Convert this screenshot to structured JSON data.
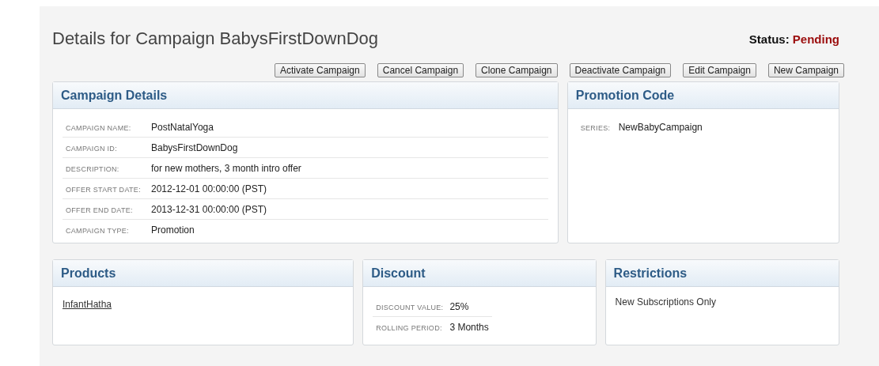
{
  "title": "Details for Campaign BabysFirstDownDog",
  "status": {
    "label": "Status:",
    "value": "Pending"
  },
  "buttons": [
    "Activate Campaign",
    "Cancel Campaign",
    "Clone Campaign",
    "Deactivate Campaign",
    "Edit Campaign",
    "New Campaign"
  ],
  "campaign_details": {
    "title": "Campaign Details",
    "fields": [
      {
        "label": "CAMPAIGN NAME:",
        "value": "PostNatalYoga"
      },
      {
        "label": "CAMPAIGN ID:",
        "value": "BabysFirstDownDog"
      },
      {
        "label": "DESCRIPTION:",
        "value": "for new mothers, 3 month intro offer"
      },
      {
        "label": "OFFER START DATE:",
        "value": "2012-12-01 00:00:00 (PST)"
      },
      {
        "label": "OFFER END DATE:",
        "value": "2013-12-31 00:00:00 (PST)"
      },
      {
        "label": "CAMPAIGN TYPE:",
        "value": "Promotion"
      }
    ]
  },
  "promotion_code": {
    "title": "Promotion Code",
    "fields": [
      {
        "label": "SERIES:",
        "value": "NewBabyCampaign"
      }
    ]
  },
  "products": {
    "title": "Products",
    "links": [
      "InfantHatha"
    ]
  },
  "discount": {
    "title": "Discount",
    "fields": [
      {
        "label": "DISCOUNT VALUE:",
        "value": "25%"
      },
      {
        "label": "ROLLING PERIOD:",
        "value": "3 Months"
      }
    ]
  },
  "restrictions": {
    "title": "Restrictions",
    "items": [
      "New Subscriptions Only"
    ]
  }
}
